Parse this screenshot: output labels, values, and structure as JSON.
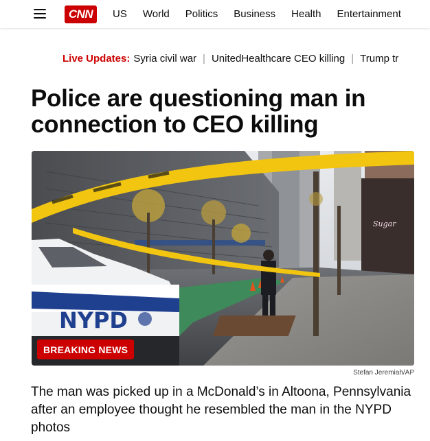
{
  "header": {
    "logo_text": "CNN",
    "nav": [
      "US",
      "World",
      "Politics",
      "Business",
      "Health",
      "Entertainment"
    ]
  },
  "live_updates": {
    "label": "Live Updates:",
    "topics": [
      "Syria civil war",
      "UnitedHealthcare CEO killing",
      "Trump tr"
    ]
  },
  "article": {
    "headline": "Police are questioning man in connection to CEO killing",
    "badge": "BREAKING NEWS",
    "photo_credit": "Stefan Jeremiah/AP",
    "summary": "The man was picked up in a McDonald’s in Altoona, Pennsylvania after an employee thought he resembled the man in the NYPD photos"
  },
  "colors": {
    "brand_red": "#cc0000",
    "tape_yellow": "#f2c511",
    "police_blue": "#1f3f8f"
  }
}
